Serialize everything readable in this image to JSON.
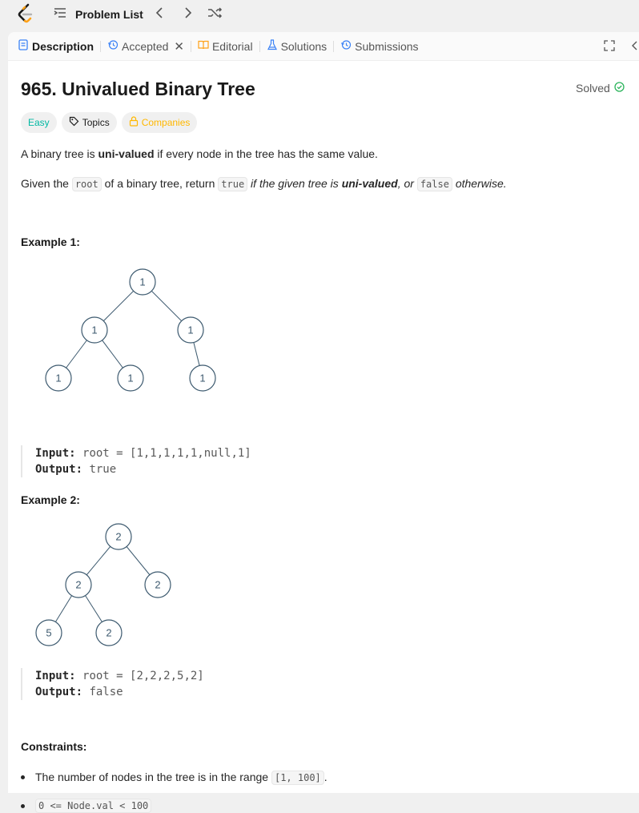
{
  "header": {
    "problem_list_label": "Problem List"
  },
  "tabs": [
    {
      "label": "Description",
      "icon": "description-icon"
    },
    {
      "label": "Accepted",
      "icon": "history-icon"
    },
    {
      "label": "Editorial",
      "icon": "book-icon"
    },
    {
      "label": "Solutions",
      "icon": "flask-icon"
    },
    {
      "label": "Submissions",
      "icon": "history-icon"
    }
  ],
  "problem": {
    "title": "965. Univalued Binary Tree",
    "status": "Solved",
    "difficulty": "Easy",
    "topics_label": "Topics",
    "companies_label": "Companies",
    "p1_pre": "A binary tree is ",
    "p1_bold": "uni-valued",
    "p1_post": " if every node in the tree has the same value.",
    "p2_a": "Given the ",
    "p2_code1": "root",
    "p2_b": " of a binary tree, return ",
    "p2_code2": "true",
    "p2_c": " if the given tree is ",
    "p2_bold": "uni-valued",
    "p2_d": ", or ",
    "p2_code3": "false",
    "p2_e": " otherwise."
  },
  "examples": [
    {
      "heading": "Example 1:",
      "input_label": "Input:",
      "input": "root = [1,1,1,1,1,null,1]",
      "output_label": "Output:",
      "output": "true",
      "nodes": [
        "1",
        "1",
        "1",
        "1",
        "1",
        "1"
      ]
    },
    {
      "heading": "Example 2:",
      "input_label": "Input:",
      "input": "root = [2,2,2,5,2]",
      "output_label": "Output:",
      "output": "false",
      "nodes": [
        "2",
        "2",
        "2",
        "5",
        "2"
      ]
    }
  ],
  "constraints": {
    "heading": "Constraints:",
    "c1_pre": "The number of nodes in the tree is in the range ",
    "c1_code": "[1, 100]",
    "c1_post": ".",
    "c2_code": "0 <= Node.val < 100"
  },
  "colors": {
    "easy": "#00b8a3",
    "companies": "#ffb800",
    "solved_check": "#2db55d",
    "logo_orange": "#ffa116"
  }
}
